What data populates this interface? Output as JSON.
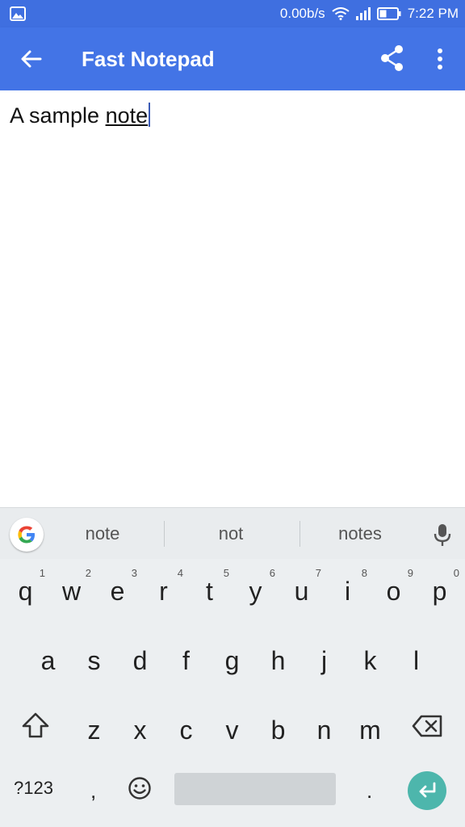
{
  "status_bar": {
    "net_speed": "0.00b/s",
    "time": "7:22 PM",
    "icons": [
      "gallery-icon",
      "wifi-icon",
      "signal-icon",
      "battery-icon"
    ]
  },
  "app_bar": {
    "title": "Fast Notepad",
    "color": "#4374e6",
    "icons": [
      "back-arrow-icon",
      "share-icon",
      "more-vert-icon"
    ]
  },
  "editor": {
    "text_prefix": "A sample ",
    "composing_word": "note"
  },
  "suggestions": {
    "items": [
      "note",
      "not",
      "notes"
    ]
  },
  "keyboard": {
    "row1": [
      {
        "ch": "q",
        "num": "1"
      },
      {
        "ch": "w",
        "num": "2"
      },
      {
        "ch": "e",
        "num": "3"
      },
      {
        "ch": "r",
        "num": "4"
      },
      {
        "ch": "t",
        "num": "5"
      },
      {
        "ch": "y",
        "num": "6"
      },
      {
        "ch": "u",
        "num": "7"
      },
      {
        "ch": "i",
        "num": "8"
      },
      {
        "ch": "o",
        "num": "9"
      },
      {
        "ch": "p",
        "num": "0"
      }
    ],
    "row2": [
      "a",
      "s",
      "d",
      "f",
      "g",
      "h",
      "j",
      "k",
      "l"
    ],
    "row3": [
      "z",
      "x",
      "c",
      "v",
      "b",
      "n",
      "m"
    ],
    "symbols_key": "?123",
    "comma_key": ",",
    "period_key": ".",
    "enter_color": "#4db6ac"
  }
}
